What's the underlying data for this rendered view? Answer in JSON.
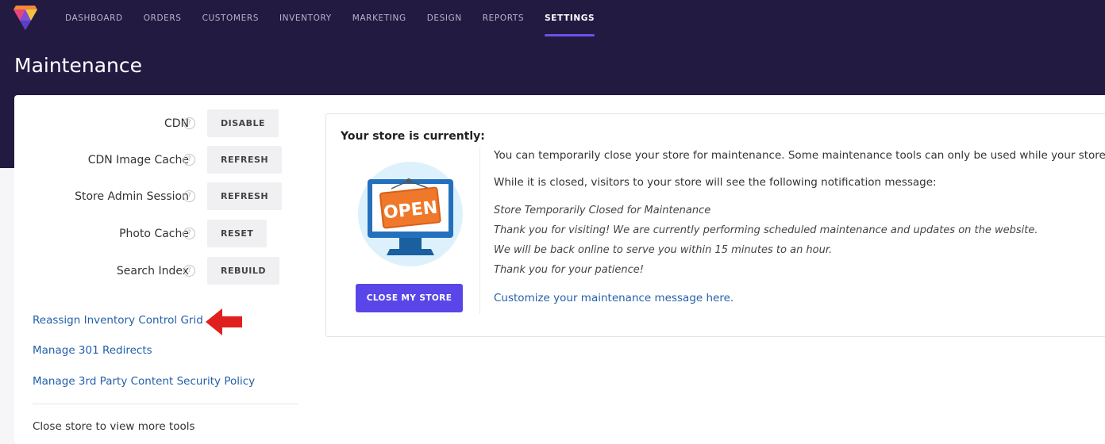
{
  "nav": {
    "items": [
      {
        "label": "DASHBOARD",
        "active": false
      },
      {
        "label": "ORDERS",
        "active": false
      },
      {
        "label": "CUSTOMERS",
        "active": false
      },
      {
        "label": "INVENTORY",
        "active": false
      },
      {
        "label": "MARKETING",
        "active": false
      },
      {
        "label": "DESIGN",
        "active": false
      },
      {
        "label": "REPORTS",
        "active": false
      },
      {
        "label": "SETTINGS",
        "active": true
      }
    ]
  },
  "page": {
    "title": "Maintenance"
  },
  "tools": [
    {
      "label": "CDN",
      "button": "DISABLE",
      "help": "?"
    },
    {
      "label": "CDN Image Cache",
      "button": "REFRESH",
      "help": "?"
    },
    {
      "label": "Store Admin Session",
      "button": "REFRESH",
      "help": "?"
    },
    {
      "label": "Photo Cache",
      "button": "RESET",
      "help": "?"
    },
    {
      "label": "Search Index",
      "button": "REBUILD",
      "help": "?"
    }
  ],
  "links": {
    "reassign": "Reassign Inventory Control Grid",
    "redirects": "Manage 301 Redirects",
    "csp": "Manage 3rd Party Content Security Policy"
  },
  "closed_note": "Close store to view more tools",
  "store": {
    "heading": "Your store is currently:",
    "sign_text": "OPEN",
    "close_button": "CLOSE MY STORE",
    "intro": "You can temporarily close your store for maintenance. Some maintenance tools can only be used while your store is closed.",
    "notice_intro": "While it is closed, visitors to your store will see the following notification message:",
    "message_lines": [
      "Store Temporarily Closed for Maintenance",
      "Thank you for visiting! We are currently performing scheduled maintenance and updates on the website.",
      "We will be back online to serve you within 15 minutes to an hour.",
      "Thank you for your patience!"
    ],
    "customize_link": "Customize your maintenance message here",
    "customize_suffix": "."
  },
  "colors": {
    "header_bg": "#221a41",
    "accent": "#5a45e8",
    "link": "#245fa8",
    "arrow": "#e0201f"
  }
}
